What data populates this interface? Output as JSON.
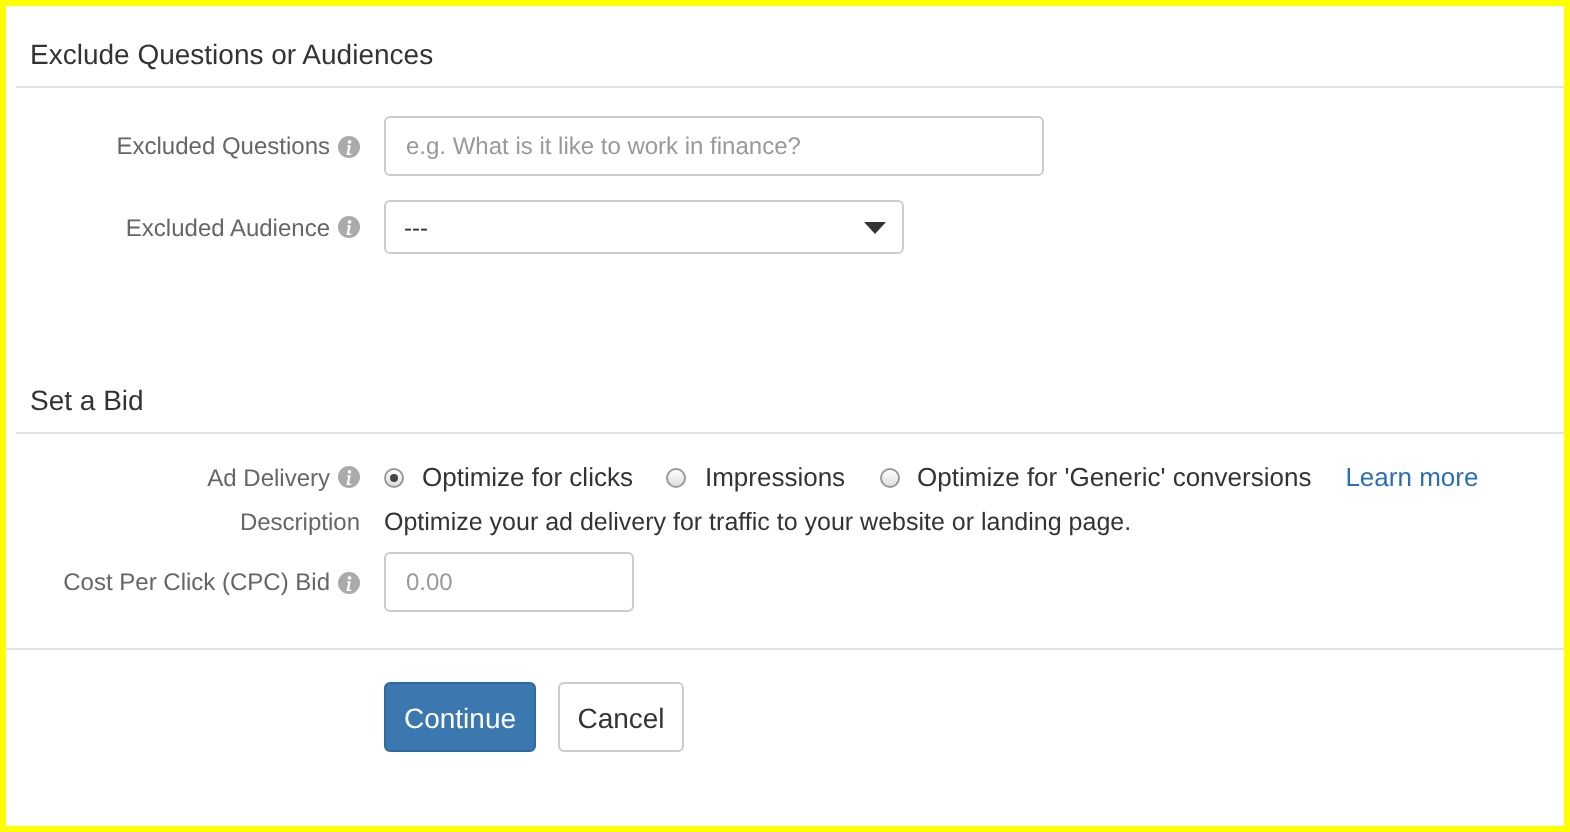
{
  "sections": [
    {
      "title": "Exclude Questions or Audiences",
      "fields": [
        {
          "kind": "input",
          "label": "Excluded Questions",
          "info": true,
          "placeholder": "e.g. What is it like to work in finance?"
        },
        {
          "kind": "select",
          "label": "Excluded Audience",
          "info": true,
          "value": "---"
        }
      ]
    },
    {
      "title": "Set a Bid",
      "fields": [
        {
          "kind": "radio",
          "label": "Ad Delivery",
          "info": true,
          "options": [
            {
              "label": "Optimize for clicks",
              "selected": true
            },
            {
              "label": "Impressions",
              "selected": false
            },
            {
              "label": "Optimize for 'Generic' conversions",
              "selected": false
            }
          ],
          "link": "Learn more"
        },
        {
          "kind": "text",
          "label": "Description",
          "info": false,
          "text": "Optimize your ad delivery for traffic to your website or landing page."
        },
        {
          "kind": "number",
          "label": "Cost Per Click (CPC) Bid",
          "info": true,
          "placeholder": "0.00"
        }
      ]
    }
  ],
  "buttons": [
    {
      "label": "Continue",
      "kind": "primary"
    },
    {
      "label": "Cancel",
      "kind": "default"
    }
  ]
}
